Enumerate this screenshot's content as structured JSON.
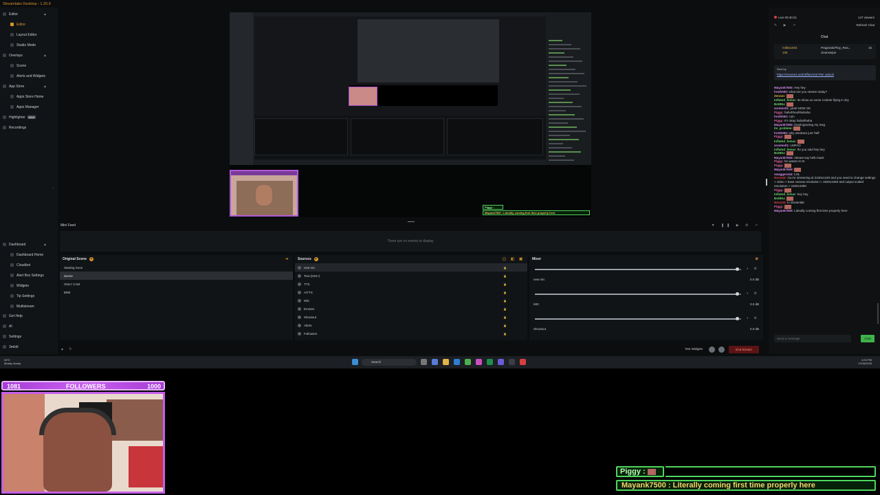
{
  "app": {
    "title": "Streamlabs Desktop - 1.20.9"
  },
  "nav": {
    "editor_section": [
      {
        "label": "Editor",
        "type": "head"
      },
      {
        "label": "Editor",
        "type": "sub",
        "active": true
      },
      {
        "label": "Layout Editor",
        "type": "sub"
      },
      {
        "label": "Studio Mode",
        "type": "sub"
      }
    ],
    "overlays_section": [
      {
        "label": "Overlays",
        "type": "head"
      },
      {
        "label": "Scene",
        "type": "sub"
      },
      {
        "label": "Alerts and Widgets",
        "type": "sub"
      }
    ],
    "appstore_section": [
      {
        "label": "App Store",
        "type": "head"
      },
      {
        "label": "Apps Store Home",
        "type": "sub"
      },
      {
        "label": "Apps Manager",
        "type": "sub"
      }
    ],
    "highlighter": {
      "label": "Highlighter",
      "badge": "beta"
    },
    "recordings": "Recordings",
    "dashboard_section": [
      {
        "label": "Dashboard",
        "type": "head"
      },
      {
        "label": "Dashboard Home",
        "type": "sub"
      },
      {
        "label": "Cloudbot",
        "type": "sub"
      },
      {
        "label": "Alert Box Settings",
        "type": "sub"
      },
      {
        "label": "Widgets",
        "type": "sub"
      },
      {
        "label": "Tip Settings",
        "type": "sub"
      },
      {
        "label": "Multistream",
        "type": "sub"
      }
    ],
    "bottom": [
      {
        "label": "Get Help"
      },
      {
        "label": "AI"
      },
      {
        "label": "Settings"
      },
      {
        "label": "3edolt"
      }
    ]
  },
  "preview": {
    "alert_user": "Piggy :",
    "alert_msg": "Mayank7500 : Literally coming first time properly here"
  },
  "mini_feed": {
    "title": "Mini Feed",
    "empty": "There are no events to display"
  },
  "scenes": {
    "title": "Original Scene",
    "items": [
      {
        "label": "Starting Soon"
      },
      {
        "label": "Scene",
        "selected": true
      },
      {
        "label": "ONLY CAM"
      },
      {
        "label": "BRB"
      }
    ]
  },
  "sources": {
    "title": "Sources",
    "items": [
      {
        "label": "new mic",
        "selected": true
      },
      {
        "label": "Text (GDI+)"
      },
      {
        "label": "TTS"
      },
      {
        "label": "AITTS"
      },
      {
        "label": "MIC"
      },
      {
        "label": "Emotes"
      },
      {
        "label": "Shoutout"
      },
      {
        "label": "Alerts"
      },
      {
        "label": "Followers"
      }
    ]
  },
  "mixer": {
    "title": "Mixer",
    "items": [
      {
        "name": "new mic",
        "db": "0.0 dB",
        "level": 0.98
      },
      {
        "name": "MIC",
        "db": "0.0 dB",
        "level": 0.98
      },
      {
        "name": "Shoutout",
        "db": "0.0 dB",
        "level": 0.98
      }
    ]
  },
  "footer": {
    "test_widgets": "Test Widgets",
    "end_stream": "End Stream"
  },
  "chat": {
    "live": "Live 00:40:21",
    "viewers": "147 viewers",
    "refresh": "Refresh Chat",
    "title": "Chat",
    "pinned": {
      "user1": "mikks1004",
      "user1_amt": "105",
      "user2_label": "PragmaticPlay_Rea...",
      "user2_amt": "15",
      "user3_label": "cleanswipe"
    },
    "sent_by": "Sent by",
    "link": "https://renvees.net/raffles/103 PW: wdooli",
    "messages": [
      {
        "user": "Mayank7500:",
        "text": "Hey hey",
        "color": "#d98df0"
      },
      {
        "user": "hrsth000:",
        "text": "what are you stream today?",
        "color": "#d98df0"
      },
      {
        "user": "Zeravo:",
        "text": "",
        "color": "#e0b44a"
      },
      {
        "user": "Inflated_femur:",
        "text": "Its show us some rockets flying in sky",
        "color": "#6ed66e"
      },
      {
        "user": "BotBtu:",
        "text": "",
        "color": "#6ed66e"
      },
      {
        "user": "zerotes01:",
        "text": "yeah NOW OK",
        "color": "#d98df0"
      },
      {
        "user": "Piggy:",
        "text": "hahohhoohhahaha",
        "color": "#e060a0"
      },
      {
        "user": "hrsth000:",
        "text": "coin",
        "color": "#d98df0"
      },
      {
        "user": "Piggy:",
        "text": "It's okay hahahhaha",
        "color": "#e060a0"
      },
      {
        "user": "Mayank7500:",
        "text": "Doolt ignoring my msg",
        "color": "#d98df0"
      },
      {
        "user": "its_problem:",
        "text": "",
        "color": "#6ed66e"
      },
      {
        "user": "hrsth000:",
        "text": "why windows just 'hell'",
        "color": "#d98df0"
      },
      {
        "user": "Piggy:",
        "text": "",
        "color": "#e060a0"
      },
      {
        "user": "Inflated_femur:",
        "text": "",
        "color": "#6ed66e"
      },
      {
        "user": "zerotes01:",
        "text": "LMFAO",
        "color": "#d98df0"
      },
      {
        "user": "Inflated_femur:",
        "text": "Ifo you said hey hey",
        "color": "#6ed66e"
      },
      {
        "user": "BotBtu:",
        "text": "",
        "color": "#6ed66e"
      },
      {
        "user": "Mayank7500:",
        "text": "Atleast say hello back",
        "color": "#d98df0"
      },
      {
        "user": "Piggy:",
        "text": "he wants HI HI",
        "color": "#e060a0"
      },
      {
        "user": "Piggy:",
        "text": "",
        "color": "#e060a0"
      },
      {
        "user": "Mayank7500:",
        "text": "",
        "color": "#d98df0"
      },
      {
        "user": "swaggerstat:",
        "text": "LOL",
        "color": "#d98df0"
      },
      {
        "user": "Nooo33:",
        "text": "You're streaming at 3440x1440 and you need to change settings > video > base canvas resolution > 1920x1080 and output scaled resolution > 1920x1080",
        "color": "#e04040"
      },
      {
        "user": "Piggy:",
        "text": "",
        "color": "#e060a0"
      },
      {
        "user": "Inflated_femur:",
        "text": "hey hey",
        "color": "#6ed66e"
      },
      {
        "user": "BotBtu:",
        "text": "",
        "color": "#6ed66e"
      },
      {
        "user": "Nooo33:",
        "text": "in streamlab",
        "color": "#e04040"
      },
      {
        "user": "Piggy:",
        "text": "",
        "color": "#e060a0"
      },
      {
        "user": "Mayank7500:",
        "text": "Literally coming first time properly here",
        "color": "#d98df0"
      }
    ],
    "send_placeholder": "Send a message",
    "send_btn": "Chat"
  },
  "taskbar": {
    "weather_temp": "28°C",
    "weather_desc": "Mostly cloudy",
    "search": "Search",
    "time": "4:03 PM",
    "date": "17/05/2025"
  },
  "overlay": {
    "followers_left": "1081",
    "followers_label": "FOLLOWERS",
    "followers_right": "1000",
    "alert_user": "Piggy :",
    "alert_msg": "Mayank7500 : Literally coming first time properly here"
  }
}
